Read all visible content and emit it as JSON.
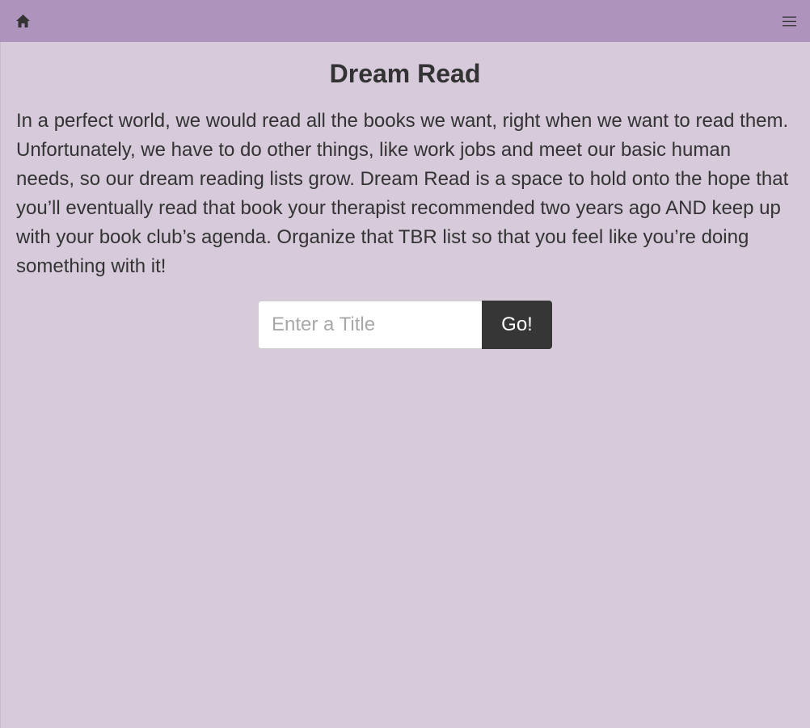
{
  "nav": {
    "home_icon": "home-icon",
    "menu_icon": "hamburger-menu-icon",
    "bar_color": "#ae93bd"
  },
  "main": {
    "title": "Dream Read",
    "intro": "In a perfect world, we would read all the books we want, right when we want to read them. Unfortunately, we have to do other things, like work jobs and meet our basic human needs, so our dream reading lists grow. Dream Read is a space to hold onto the hope that you’ll eventually read that book your therapist recommended two years ago AND keep up with your book club’s agenda. Organize that TBR list so that you feel like you’re doing something with it!",
    "background_color": "#d6cadb"
  },
  "search": {
    "placeholder": "Enter a Title",
    "value": "",
    "button_label": "Go!",
    "button_color": "#363636"
  }
}
